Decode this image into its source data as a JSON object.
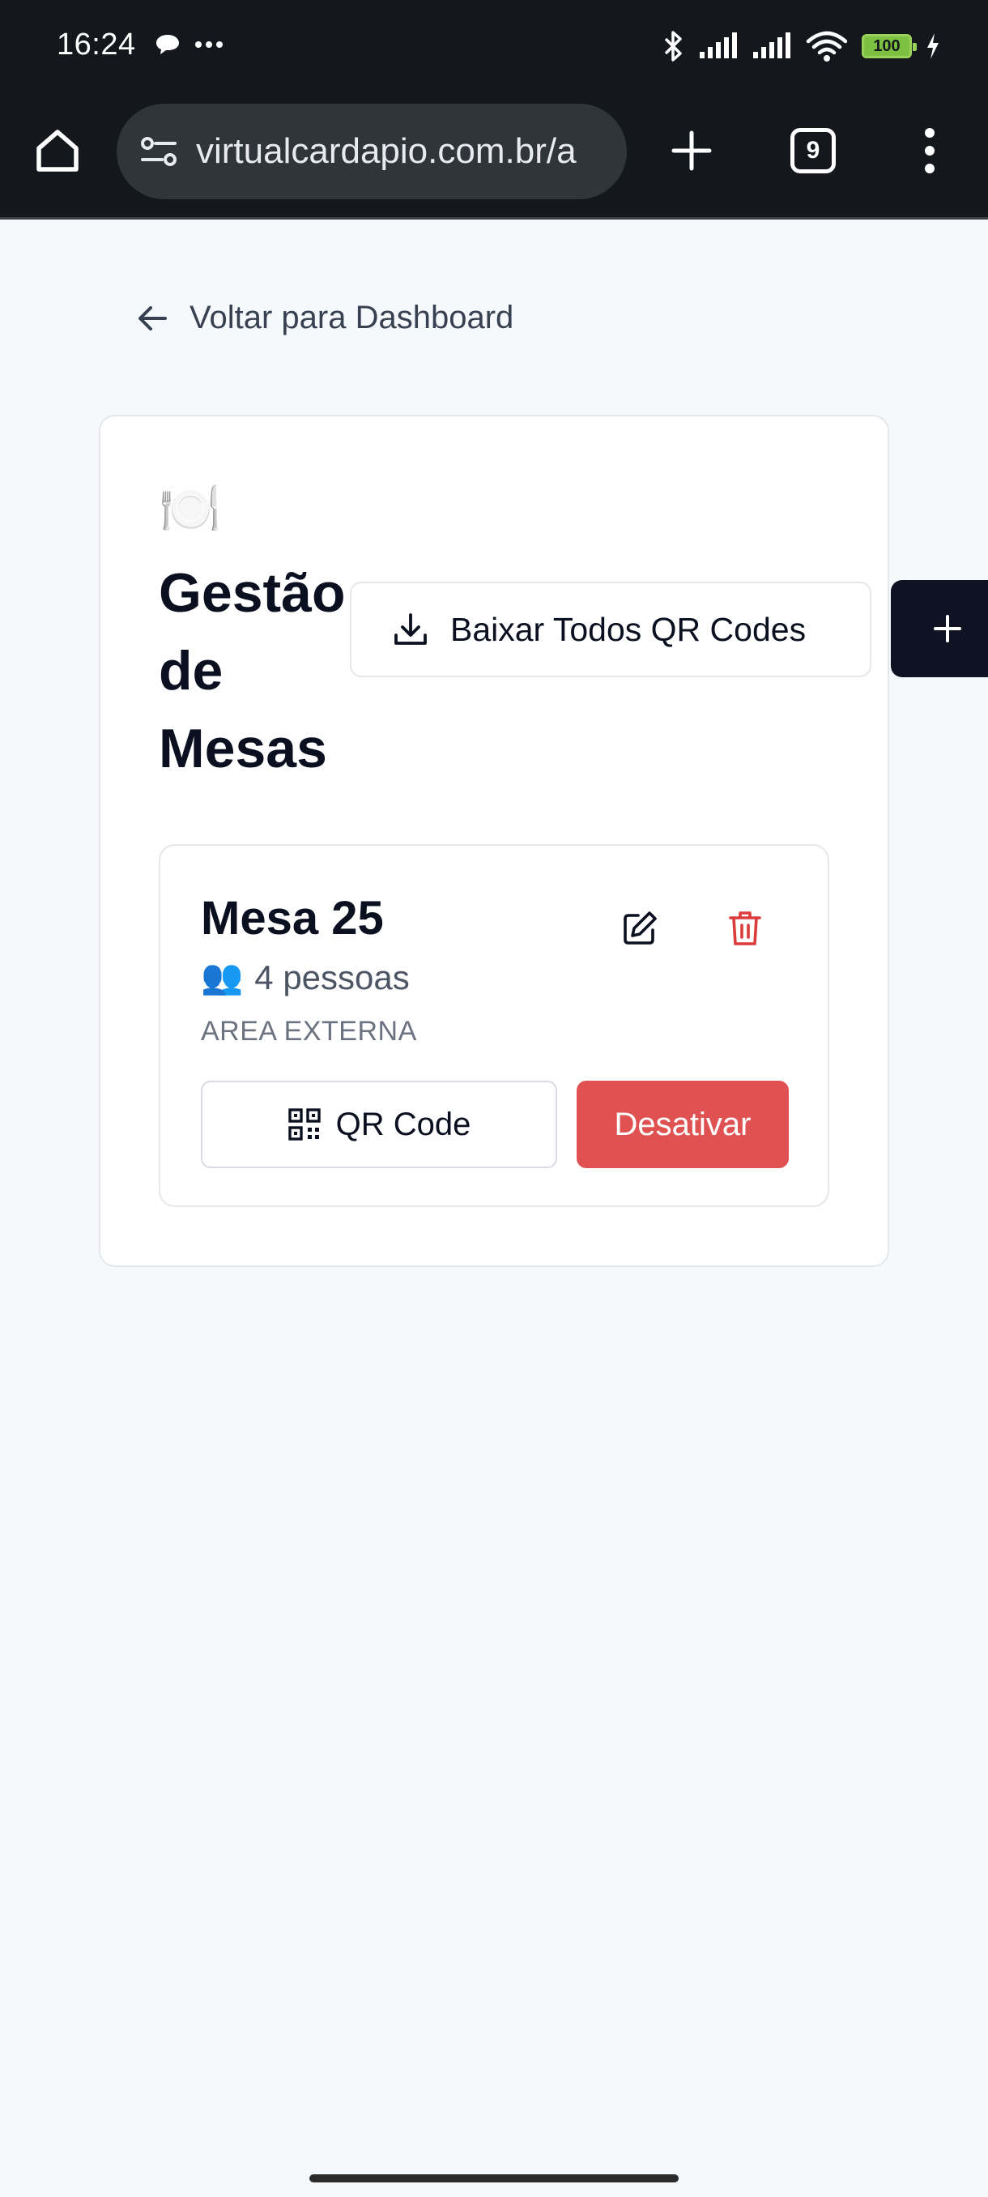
{
  "status_bar": {
    "time": "16:24",
    "left_icons": [
      "chat-bubble-icon",
      "more-dots-icon"
    ],
    "right_icons": [
      "bluetooth-icon",
      "signal-icon",
      "signal-icon",
      "wifi-icon",
      "battery-icon",
      "charging-icon"
    ],
    "battery_level": "100"
  },
  "browser": {
    "url": "virtualcardapio.com.br/a",
    "tab_count": "9"
  },
  "page": {
    "back_label": "Voltar para Dashboard",
    "title_icon": "🍽️",
    "title": "Gestão de Mesas",
    "download_all_label": "Baixar Todos QR Codes",
    "add_label": "+"
  },
  "tables": [
    {
      "name": "Mesa 25",
      "capacity_icon": "👥",
      "capacity": "4 pessoas",
      "area": "AREA EXTERNA",
      "qr_label": "QR Code",
      "deactivate_label": "Desativar"
    }
  ],
  "colors": {
    "chrome_bg": "#14181d",
    "page_bg": "#f6f9fc",
    "danger": "#e05252",
    "dark_button": "#0f1223"
  }
}
